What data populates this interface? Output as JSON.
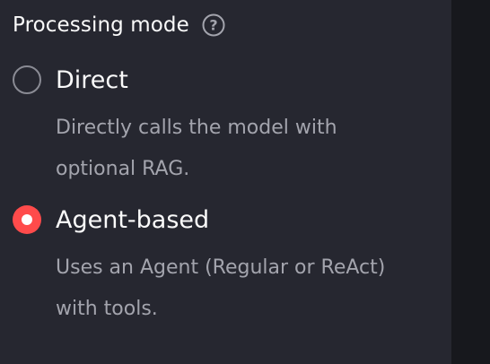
{
  "section": {
    "title": "Processing mode",
    "help_icon": "question-circle-icon"
  },
  "options": [
    {
      "label": "Direct",
      "description": "Directly calls the model with optional RAG.",
      "selected": false
    },
    {
      "label": "Agent-based",
      "description": "Uses an Agent (Regular or ReAct) with tools.",
      "selected": true
    }
  ],
  "colors": {
    "background": "#262730",
    "accent": "#ff4b4b",
    "text": "#fafafa",
    "muted_text": "#a3a4ad",
    "right_strip": "#17181d"
  }
}
